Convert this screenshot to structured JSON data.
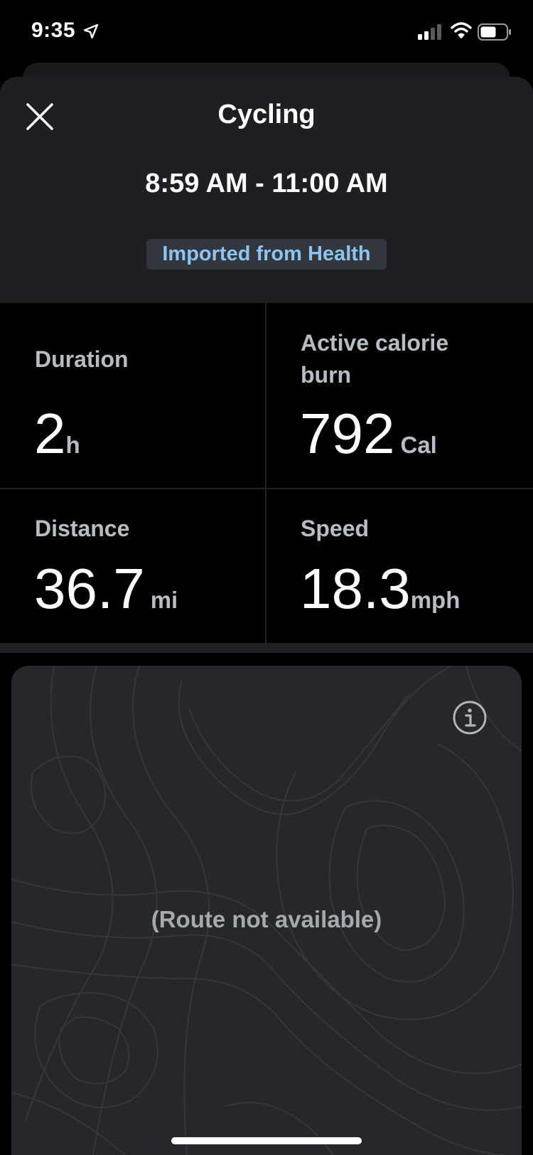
{
  "status_bar": {
    "time": "9:35"
  },
  "header": {
    "title": "Cycling",
    "time_range": "8:59 AM - 11:00 AM",
    "source_badge": "Imported from Health"
  },
  "stats": {
    "duration": {
      "label": "Duration",
      "value": "2",
      "unit": "h"
    },
    "calories": {
      "label_line1": "Active calorie",
      "label_line2": "burn",
      "value": "792",
      "unit": "Cal"
    },
    "distance": {
      "label": "Distance",
      "value": "36.7",
      "unit": "mi"
    },
    "speed": {
      "label": "Speed",
      "value": "18.3",
      "unit": "mph"
    }
  },
  "map": {
    "message": "(Route not available)"
  },
  "colors": {
    "background": "#000000",
    "sheet": "#1e1f22",
    "badge_text": "#8cc4f2",
    "badge_bg": "#33363c",
    "label": "#b8bcc4",
    "map_card": "#26272b"
  }
}
